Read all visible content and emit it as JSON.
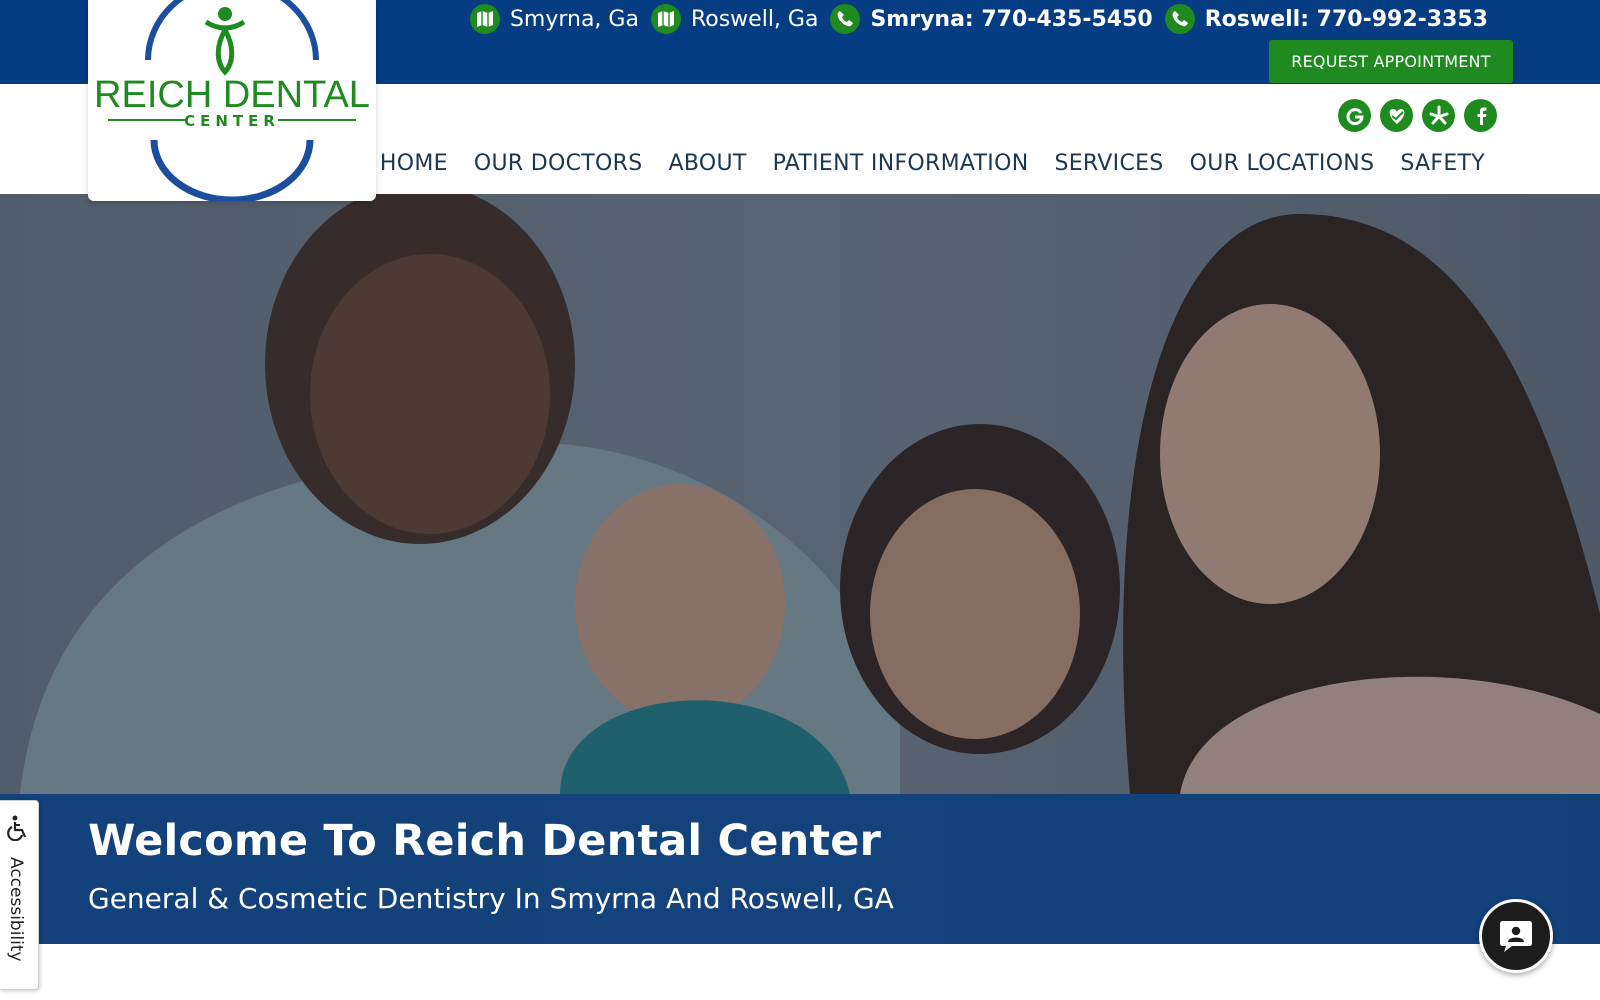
{
  "brand": {
    "logo_text_main": "REICH DENTAL",
    "logo_text_sub": "CENTER",
    "colors": {
      "navy": "#063c82",
      "green": "#1f8a1f",
      "nav_text": "#1b3650"
    }
  },
  "contact": {
    "smyrna_map_label": "Smyrna, Ga",
    "roswell_map_label": "Roswell, Ga",
    "smyrna_phone_label": "Smryna: 770-435-5450",
    "roswell_phone_label": "Roswell: 770-992-3353",
    "map_icon": "map-icon",
    "phone_icon": "phone-icon"
  },
  "header": {
    "request_button_label": "REQUEST APPOINTMENT"
  },
  "social": [
    {
      "name": "google",
      "icon": "google-icon"
    },
    {
      "name": "healthgrades",
      "icon": "healthgrades-icon"
    },
    {
      "name": "yelp",
      "icon": "yelp-icon"
    },
    {
      "name": "facebook",
      "icon": "facebook-icon"
    }
  ],
  "nav": {
    "items": [
      "HOME",
      "OUR DOCTORS",
      "ABOUT",
      "PATIENT INFORMATION",
      "SERVICES",
      "OUR LOCATIONS",
      "SAFETY"
    ]
  },
  "hero": {
    "title": "Welcome To Reich Dental Center",
    "subtitle": "General & Cosmetic Dentistry In Smyrna And Roswell, GA"
  },
  "widgets": {
    "accessibility_label": "Accessibility",
    "chat_icon": "chat-icon"
  }
}
